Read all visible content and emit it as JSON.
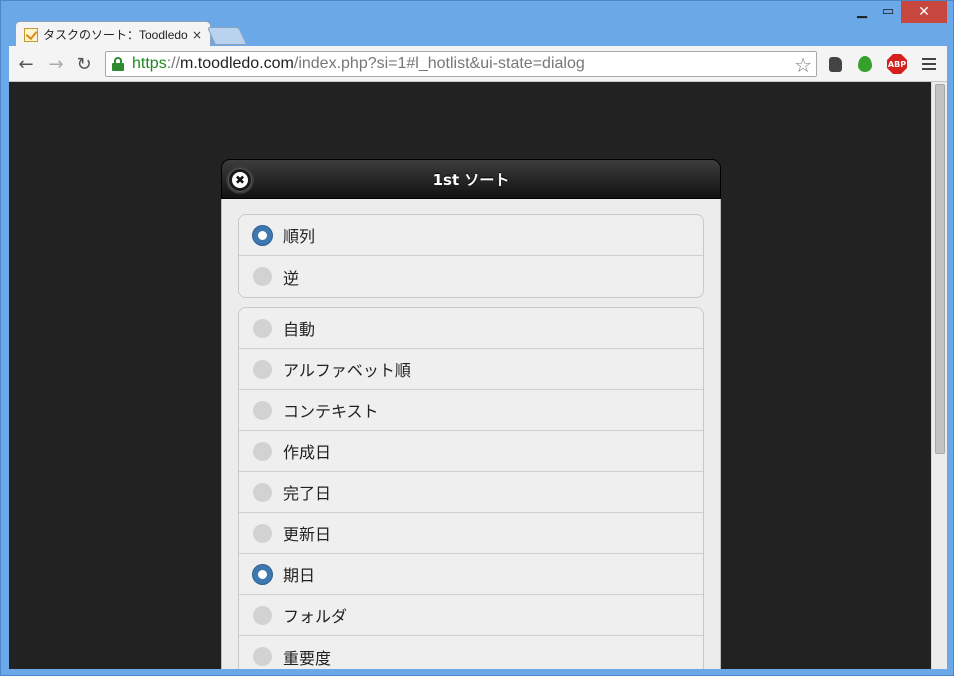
{
  "browser": {
    "tab_title": "タスクのソート：Toodledo",
    "tab_close": "×",
    "url_scheme": "https",
    "url_sep": "://",
    "url_host": "m.toodledo.com",
    "url_path": "/index.php?si=1#l_hotlist&ui-state=dialog",
    "back": "←",
    "forward": "→",
    "reload": "↻",
    "star": "☆",
    "abp_label": "ABP",
    "minimize": "▁",
    "maximize": "▭",
    "close": "✕"
  },
  "dialog": {
    "title": "1st ソート",
    "close_symbol": "✖",
    "order_options": [
      {
        "label": "順列",
        "selected": true
      },
      {
        "label": "逆",
        "selected": false
      }
    ],
    "field_options": [
      {
        "label": "自動",
        "selected": false
      },
      {
        "label": "アルファベット順",
        "selected": false
      },
      {
        "label": "コンテキスト",
        "selected": false
      },
      {
        "label": "作成日",
        "selected": false
      },
      {
        "label": "完了日",
        "selected": false
      },
      {
        "label": "更新日",
        "selected": false
      },
      {
        "label": "期日",
        "selected": true
      },
      {
        "label": "フォルダ",
        "selected": false
      },
      {
        "label": "重要度",
        "selected": false
      }
    ]
  },
  "colors": {
    "radio_selected": "#3d79b0",
    "page_background": "#222222",
    "url_scheme": "#1e8a1e"
  }
}
